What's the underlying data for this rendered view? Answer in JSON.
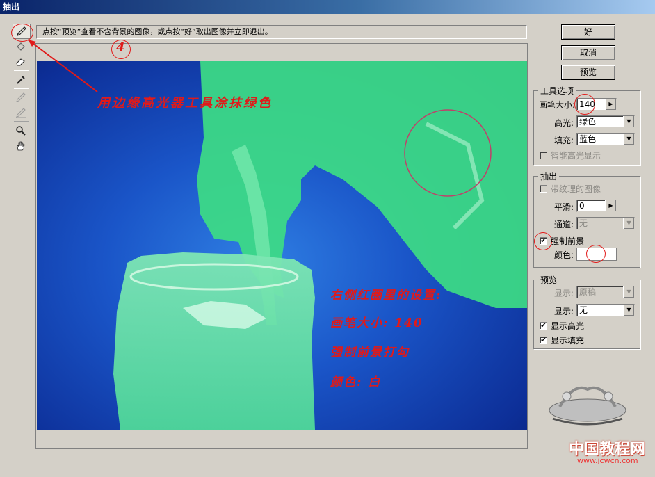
{
  "window": {
    "title": "抽出"
  },
  "hint": {
    "text": "点按“预览”查看不含背景的图像，或点按“好”取出图像并立即退出。"
  },
  "toolbar": {
    "tools": [
      {
        "name": "edge-highlighter-icon",
        "glyph": "✎"
      },
      {
        "name": "fill-icon",
        "glyph": "◇"
      },
      {
        "name": "eraser-icon",
        "glyph": "▱"
      },
      {
        "name": "eyedropper-icon",
        "glyph": "⁄"
      },
      {
        "name": "cleanup-icon",
        "glyph": "✐"
      },
      {
        "name": "edge-touchup-icon",
        "glyph": "✐"
      },
      {
        "name": "zoom-icon",
        "glyph": "🔍"
      },
      {
        "name": "hand-icon",
        "glyph": "✋"
      }
    ]
  },
  "buttons": {
    "ok": "好",
    "cancel": "取消",
    "preview": "预览"
  },
  "tool_options": {
    "title": "工具选项",
    "brush_size_label": "画笔大小:",
    "brush_size_value": "140",
    "highlight_label": "高光:",
    "highlight_value": "绿色",
    "fill_label": "填充:",
    "fill_value": "蓝色",
    "smart_highlight_label": "智能高光显示"
  },
  "extraction": {
    "title": "抽出",
    "textured_label": "带纹理的图像",
    "smooth_label": "平滑:",
    "smooth_value": "0",
    "channel_label": "通道:",
    "channel_value": "无",
    "force_fg_label": "强制前景",
    "force_fg_checked": true,
    "color_label": "颜色:",
    "color_value": "#ffffff"
  },
  "preview_group": {
    "title": "预览",
    "show1_label": "显示:",
    "show1_value": "原稿",
    "show2_label": "显示:",
    "show2_value": "无",
    "show_highlight_label": "显示高光",
    "show_highlight_checked": true,
    "show_fill_label": "显示填充",
    "show_fill_checked": true
  },
  "annotations": {
    "step_number": "4",
    "instruction": "用边缘高光器工具涂抹绿色",
    "right_settings_title": "右侧红圈里的设置:",
    "brush_size_note": "画笔大小: 140",
    "force_fg_note": "强制前景打勾",
    "color_note": "颜色: 白"
  },
  "watermark": {
    "text": "中国教程网",
    "url": "www.jcwcn.com"
  },
  "colors": {
    "highlight_green": "#3ddc84",
    "annotation_red": "#e01a1a",
    "title_bar": "#0a246a"
  }
}
